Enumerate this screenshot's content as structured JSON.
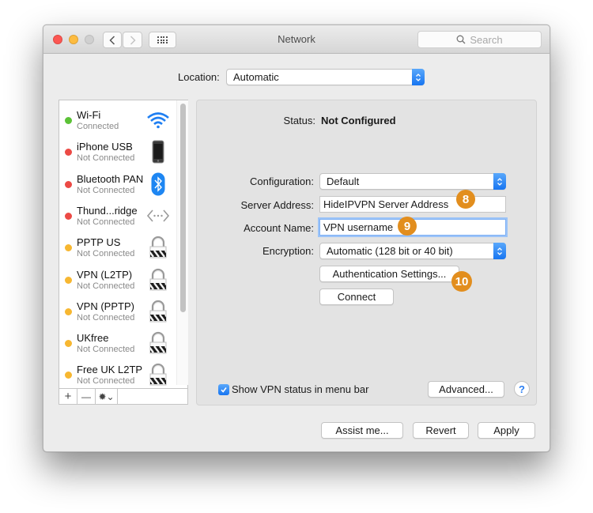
{
  "window": {
    "title": "Network",
    "search_placeholder": "Search"
  },
  "location": {
    "label": "Location:",
    "value": "Automatic"
  },
  "services": [
    {
      "name": "Wi-Fi",
      "status": "Connected",
      "status_color": "#5bc236",
      "icon": "wifi-icon"
    },
    {
      "name": "iPhone USB",
      "status": "Not Connected",
      "status_color": "#ec4a45",
      "icon": "iphone-icon"
    },
    {
      "name": "Bluetooth PAN",
      "status": "Not Connected",
      "status_color": "#ec4a45",
      "icon": "bluetooth-icon"
    },
    {
      "name": "Thund...ridge",
      "status": "Not Connected",
      "status_color": "#ec4a45",
      "icon": "thunderbolt-bridge-icon"
    },
    {
      "name": "PPTP US",
      "status": "Not Connected",
      "status_color": "#f7b731",
      "icon": "vpn-lock-icon"
    },
    {
      "name": "VPN (L2TP)",
      "status": "Not Connected",
      "status_color": "#f7b731",
      "icon": "vpn-lock-icon"
    },
    {
      "name": "VPN (PPTP)",
      "status": "Not Connected",
      "status_color": "#f7b731",
      "icon": "vpn-lock-icon"
    },
    {
      "name": "UKfree",
      "status": "Not Connected",
      "status_color": "#f7b731",
      "icon": "vpn-lock-icon"
    },
    {
      "name": "Free UK L2TP",
      "status": "Not Connected",
      "status_color": "#f7b731",
      "icon": "vpn-lock-icon"
    }
  ],
  "sidebar_tools": {
    "add": "+",
    "remove": "—",
    "gear": "✹⌄"
  },
  "detail": {
    "status_label": "Status:",
    "status_value": "Not Configured",
    "configuration_label": "Configuration:",
    "configuration_value": "Default",
    "server_label": "Server Address:",
    "server_value": "HideIPVPN Server Address",
    "account_label": "Account Name:",
    "account_value": "VPN username",
    "encryption_label": "Encryption:",
    "encryption_value": "Automatic (128 bit or 40 bit)",
    "auth_button": "Authentication Settings...",
    "connect_button": "Connect",
    "show_status_label": "Show VPN status in menu bar",
    "show_status_checked": true,
    "advanced_button": "Advanced...",
    "help": "?"
  },
  "annotations": {
    "step_server": "8",
    "step_account": "9",
    "step_auth": "10",
    "color": "#e28e1e"
  },
  "footer": {
    "assist_button": "Assist me...",
    "revert_button": "Revert",
    "apply_button": "Apply"
  }
}
